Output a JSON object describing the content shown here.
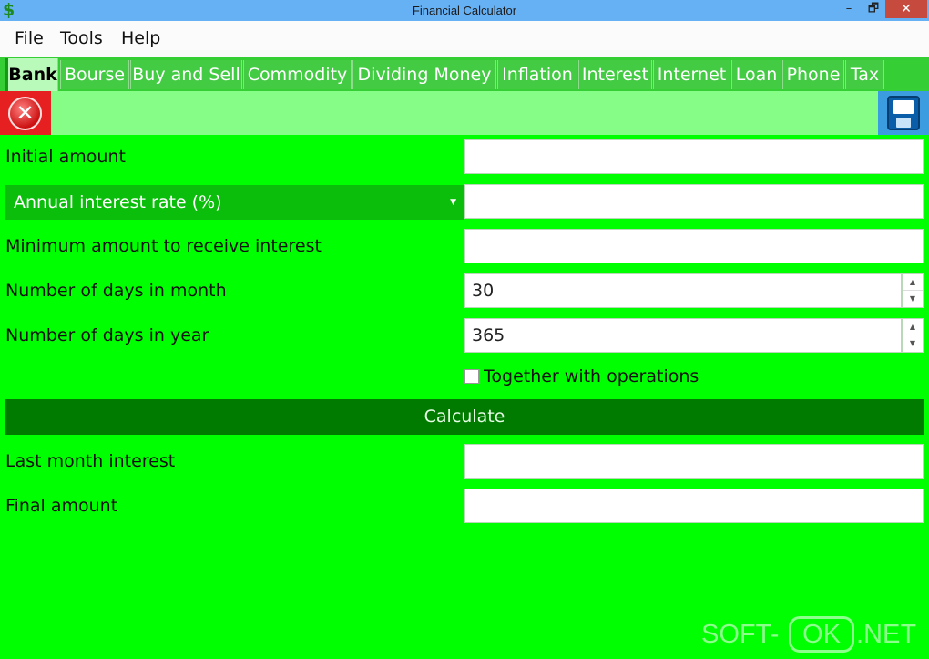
{
  "window": {
    "title": "Financial Calculator",
    "icon_glyph": "$",
    "min_glyph": "–",
    "max_glyph": "🗗",
    "close_glyph": "✕"
  },
  "menu": {
    "items": [
      "File",
      "Tools",
      "Help"
    ]
  },
  "tabs": [
    {
      "label": "Bank",
      "active": true
    },
    {
      "label": "Bourse",
      "active": false
    },
    {
      "label": "Buy and Sell",
      "active": false
    },
    {
      "label": "Commodity",
      "active": false
    },
    {
      "label": "Dividing Money",
      "active": false
    },
    {
      "label": "Inflation",
      "active": false
    },
    {
      "label": "Interest",
      "active": false
    },
    {
      "label": "Internet",
      "active": false
    },
    {
      "label": "Loan",
      "active": false
    },
    {
      "label": "Phone",
      "active": false
    },
    {
      "label": "Tax",
      "active": false
    }
  ],
  "toolbar": {
    "close_icon": "close-icon",
    "close_glyph": "✕",
    "save_icon": "floppy-disk-icon"
  },
  "form": {
    "initial_amount": {
      "label": "Initial amount",
      "value": ""
    },
    "annual_interest_rate": {
      "selected": "Annual interest rate (%)",
      "value": "",
      "caret": "▼"
    },
    "minimum_amount": {
      "label": "Minimum amount to receive interest",
      "value": ""
    },
    "days_in_month": {
      "label": "Number of days in month",
      "value": "30"
    },
    "days_in_year": {
      "label": "Number of days in year",
      "value": "365"
    },
    "spin_up": "▲",
    "spin_down": "▼",
    "together_with_operations": {
      "label": "Together with operations",
      "checked": false
    },
    "calculate_label": "Calculate",
    "last_month_interest": {
      "label": "Last month interest",
      "value": ""
    },
    "final_amount": {
      "label": "Final amount",
      "value": ""
    }
  },
  "watermark": {
    "prefix": "SOFT-",
    "boxed": "OK",
    "suffix": ".NET"
  },
  "colors": {
    "background": "#00ff00",
    "titlebar": "#66b1f4",
    "toolbar": "#86fd86",
    "calculate_button": "#007b00",
    "close_button": "#e62020",
    "save_button": "#3c9ce0"
  }
}
